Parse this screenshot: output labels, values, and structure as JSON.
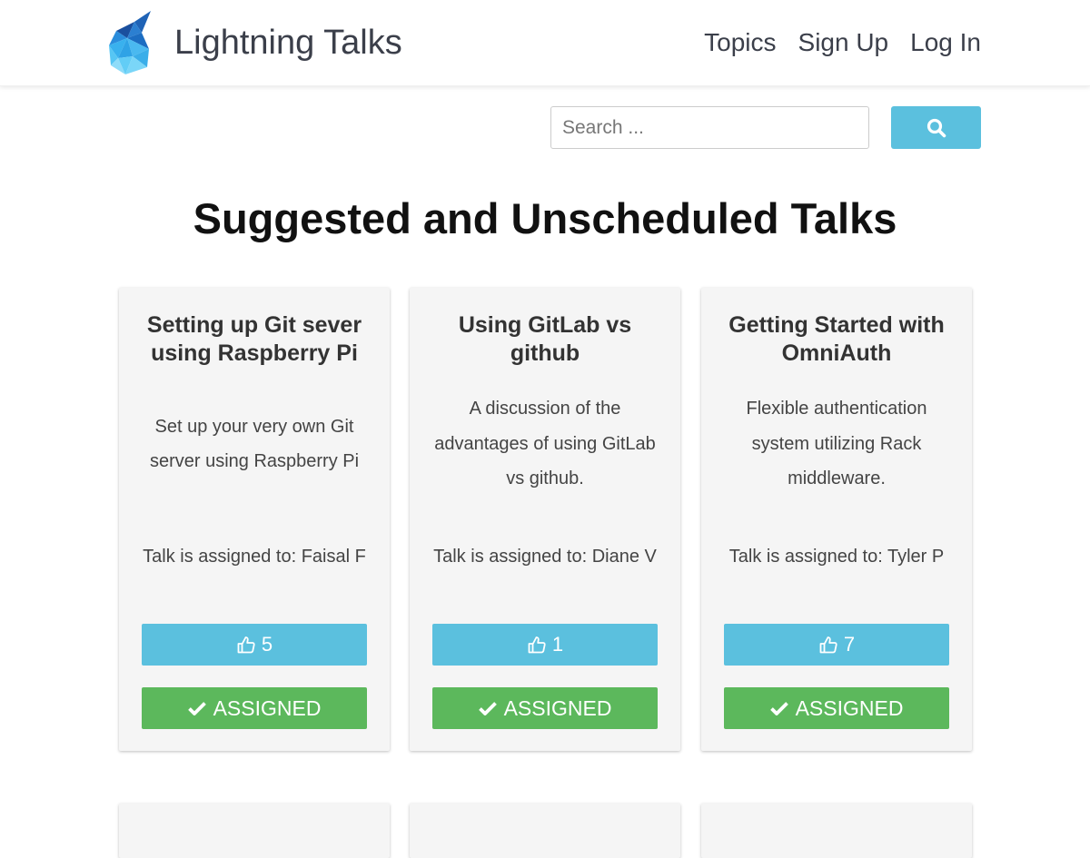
{
  "header": {
    "brand_title": "Lightning Talks",
    "logo_icon": "lightning-talks-logo-icon",
    "nav": [
      "Topics",
      "Sign Up",
      "Log In"
    ]
  },
  "search": {
    "placeholder": "Search ...",
    "value": "",
    "button_icon": "search-icon"
  },
  "page_title": "Suggested and Unscheduled Talks",
  "talks": [
    {
      "title": "Setting up Git sever using Raspberry Pi",
      "description": "Set up your very own Git server using Raspberry Pi",
      "assignee": "Talk is assigned to: Faisal F",
      "votes": "5",
      "status": "ASSIGNED"
    },
    {
      "title": "Using GitLab vs github",
      "description": "A discussion of the advantages of using GitLab vs github.",
      "assignee": "Talk is assigned to: Diane V",
      "votes": "1",
      "status": "ASSIGNED"
    },
    {
      "title": "Getting Started with OmniAuth",
      "description": "Flexible authentication system utilizing Rack middleware.",
      "assignee": "Talk is assigned to: Tyler P",
      "votes": "7",
      "status": "ASSIGNED"
    }
  ],
  "colors": {
    "info_button": "#5bc0de",
    "success_button": "#5cb85c",
    "card_background": "#f5f5f5"
  },
  "icons": {
    "vote": "thumbs-up-icon",
    "assigned": "check-icon"
  }
}
